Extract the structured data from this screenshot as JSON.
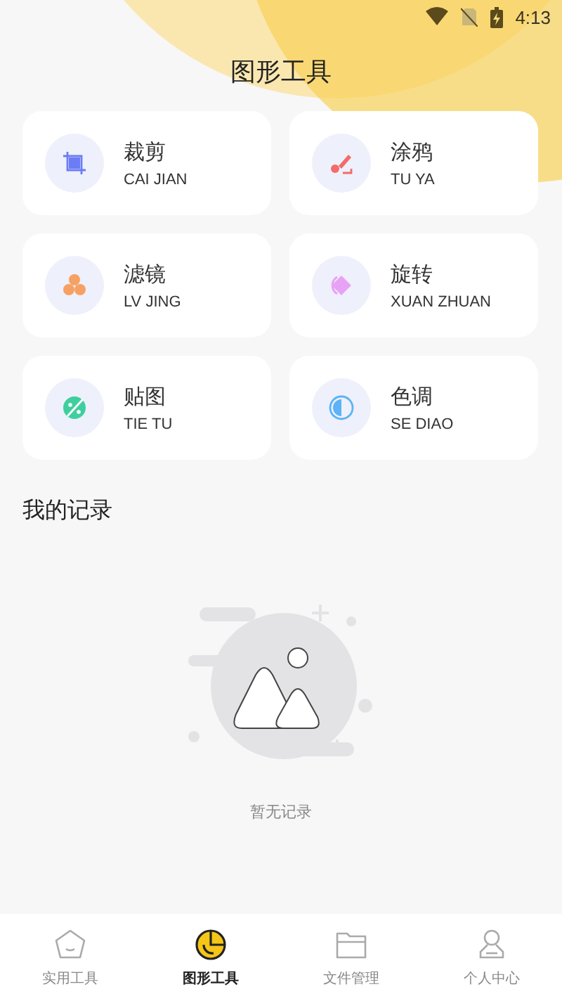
{
  "status_bar": {
    "time": "4:13"
  },
  "header": {
    "title": "图形工具"
  },
  "tools": [
    {
      "kind": "crop",
      "title": "裁剪",
      "subtitle": "CAI JIAN",
      "color": "#6b7cf6"
    },
    {
      "kind": "brush",
      "title": "涂鸦",
      "subtitle": "TU YA",
      "color": "#f36b6b"
    },
    {
      "kind": "filter",
      "title": "滤镜",
      "subtitle": "LV JING",
      "color": "#f7a063"
    },
    {
      "kind": "rotate",
      "title": "旋转",
      "subtitle": "XUAN ZHUAN",
      "color": "#e8a2f5"
    },
    {
      "kind": "sticker",
      "title": "贴图",
      "subtitle": "TIE TU",
      "color": "#3fcf9e"
    },
    {
      "kind": "tone",
      "title": "色调",
      "subtitle": "SE DIAO",
      "color": "#5cb3f5"
    }
  ],
  "records": {
    "title": "我的记录",
    "empty_text": "暂无记录"
  },
  "nav": [
    {
      "kind": "home",
      "label": "实用工具",
      "selected": false
    },
    {
      "kind": "chart",
      "label": "图形工具",
      "selected": true
    },
    {
      "kind": "folder",
      "label": "文件管理",
      "selected": false
    },
    {
      "kind": "user",
      "label": "个人中心",
      "selected": false
    }
  ]
}
